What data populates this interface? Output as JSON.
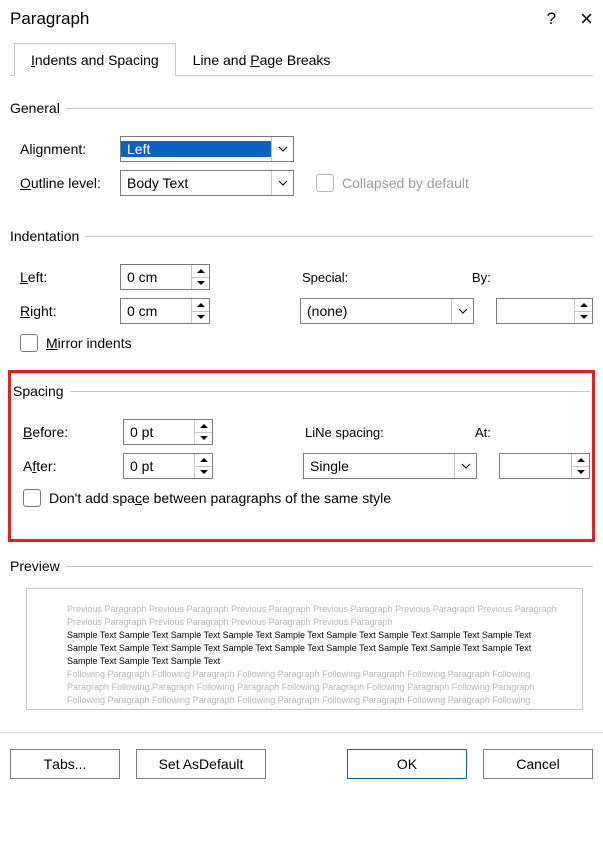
{
  "title": "Paragraph",
  "help": "?",
  "close": "×",
  "tabs": {
    "t1": "ndents and Spacing",
    "t1_u": "I",
    "t2_a": "Line and ",
    "t2_u": "P",
    "t2_b": "age Breaks"
  },
  "general": {
    "legend": "General",
    "alignment_u": "G",
    "alignment_label": "Alignment:",
    "alignment_value": "Left",
    "outline_u": "O",
    "outline_label": "utline level:",
    "outline_value": "Body Text",
    "collapsed": "Collapsed by default"
  },
  "indent": {
    "legend": "Indentation",
    "left_u": "L",
    "left_label": "eft:",
    "left_value": "0 cm",
    "right_u": "R",
    "right_label": "ight:",
    "right_value": "0 cm",
    "special_u": "S",
    "special_label": "pecial:",
    "special_value": "(none)",
    "by_u": "y",
    "by_label_a": "B",
    "by_label_b": ":",
    "by_value": "",
    "mirror_u": "M",
    "mirror_label": "irror indents"
  },
  "spacing": {
    "legend": "Spacing",
    "before_u": "B",
    "before_label": "efore:",
    "before_value": "0 pt",
    "after_u": "f",
    "after_label_a": "A",
    "after_label_b": "ter:",
    "after_value": "0 pt",
    "line_u": "N",
    "line_label_a": "Li",
    "line_label_b": "e spacing:",
    "line_value": "Single",
    "at_u": "A",
    "at_label": "t:",
    "at_value": "",
    "noadd_u": "c",
    "noadd_a": "Don't add spa",
    "noadd_b": "e between paragraphs of the same style"
  },
  "preview": {
    "legend": "Preview",
    "prev": "Previous Paragraph Previous Paragraph Previous Paragraph Previous Paragraph Previous Paragraph Previous Paragraph Previous Paragraph Previous Paragraph Previous Paragraph Previous Paragraph",
    "sample": "Sample Text Sample Text Sample Text Sample Text Sample Text Sample Text Sample Text Sample Text Sample Text Sample Text Sample Text Sample Text Sample Text Sample Text Sample Text Sample Text Sample Text Sample Text Sample Text Sample Text Sample Text",
    "foll": "Following Paragraph Following Paragraph Following Paragraph Following Paragraph Following Paragraph Following Paragraph Following Paragraph Following Paragraph Following Paragraph Following Paragraph Following Paragraph Following Paragraph Following Paragraph Following Paragraph Following Paragraph Following Paragraph Following Paragraph Following Paragraph Following Paragraph Following Paragraph Following Paragraph Following Paragraph Following Paragraph Following Paragraph Following Paragraph"
  },
  "footer": {
    "tabs_u": "T",
    "tabs": "abs...",
    "default_u": "D",
    "default_a": "Set As ",
    "default_b": "efault",
    "ok": "OK",
    "cancel": "Cancel"
  }
}
